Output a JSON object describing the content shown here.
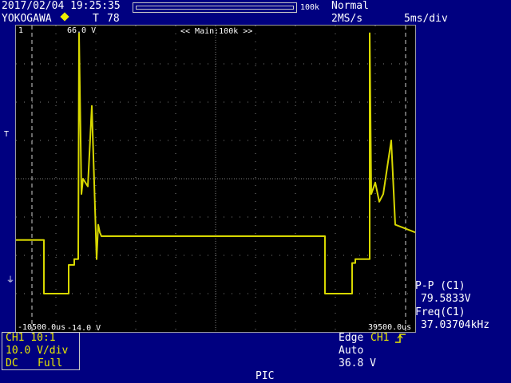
{
  "header": {
    "datetime": "2017/02/04 19:25:35",
    "brand": "YOKOGAWA",
    "trigger_pos_marker": "T",
    "trigger_pos_value": "78",
    "mem_bar_label": "100k",
    "acq_mode": "Normal",
    "sample_rate": "2MS/s",
    "timebase": "5ms/div"
  },
  "screen": {
    "top_level": "66.0 V",
    "channel_marker": "1",
    "zoom_label": "<< Main:100k >>",
    "bottom_level": "-14.0 V",
    "time_left": "-10500.0us",
    "time_right": "39500.0us",
    "trigger_level_marker": "T",
    "ground_marker": "⏚"
  },
  "measurements": {
    "pp_label": "P-P (C1)",
    "pp_value": "79.5833V",
    "freq_label": "Freq(C1)",
    "freq_value": "37.03704kHz"
  },
  "channel": {
    "name": "CH1 10:1",
    "vdiv": "10.0 V/div",
    "coupling": "DC",
    "bandwidth": "Full"
  },
  "trigger": {
    "type": "Edge",
    "source": "CH1",
    "slope_icon": "rising-edge-icon",
    "mode": "Auto",
    "level": "36.8 V"
  },
  "footer": {
    "label": "PIC"
  },
  "colors": {
    "trace": "#d8d800",
    "grid": "#808080",
    "background": "#000080"
  },
  "chart_data": {
    "type": "line",
    "x_unit": "ms",
    "y_unit": "V",
    "xlim": [
      -10.5,
      39.5
    ],
    "ylim": [
      -14.0,
      66.0
    ],
    "grid": true,
    "series": [
      {
        "x": [
          -10.5,
          -7.0,
          -7.0,
          -3.9,
          -3.9,
          -3.2,
          -3.2,
          -2.7,
          -2.6,
          -2.3,
          -2.1,
          -1.5,
          -1.0,
          -0.4,
          -0.2,
          0.0,
          0.2,
          1.0,
          14.0,
          28.2,
          28.2,
          31.6,
          31.6,
          32.0,
          32.0,
          33.8,
          33.8,
          34.0,
          34.5,
          35.0,
          35.5,
          36.5,
          37.0,
          39.5
        ],
        "y": [
          10.0,
          10.0,
          -4.0,
          -4.0,
          3.5,
          3.5,
          5.0,
          5.0,
          64.0,
          22.0,
          26.0,
          24.0,
          45.0,
          5.0,
          14.0,
          12.0,
          11.0,
          11.0,
          11.0,
          11.0,
          -4.0,
          -4.0,
          4.0,
          4.0,
          5.0,
          5.0,
          64.0,
          22.0,
          25.0,
          20.0,
          22.0,
          36.0,
          14.0,
          12.0
        ]
      }
    ]
  }
}
